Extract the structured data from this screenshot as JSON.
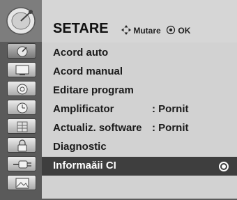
{
  "header": {
    "title": "SETARE",
    "hint_move_icon": "four-arrow-icon",
    "hint_move": "Mutare",
    "hint_ok_icon": "ok-circle-icon",
    "hint_ok": "OK"
  },
  "icons": {
    "big": "satellite-dish-icon",
    "column": [
      "satellite-icon",
      "monitor-icon",
      "speaker-icon",
      "clock-icon",
      "grid-icon",
      "lock-icon",
      "cable-plug-icon",
      "photo-icon"
    ]
  },
  "menu": {
    "items": [
      {
        "label": "Acord auto",
        "value": ""
      },
      {
        "label": "Acord manual",
        "value": ""
      },
      {
        "label": "Editare program",
        "value": ""
      },
      {
        "label": "Amplificator",
        "value": ": Pornit"
      },
      {
        "label": "Actualiz. software",
        "value": ": Pornit"
      },
      {
        "label": "Diagnostic",
        "value": ""
      },
      {
        "label": "Informaăii CI",
        "value": "",
        "selected": true
      }
    ]
  },
  "colors": {
    "selected_background": "#3e3e3e",
    "panel_background": "#d2d2d2",
    "icon_column": "#5a5a5a"
  }
}
